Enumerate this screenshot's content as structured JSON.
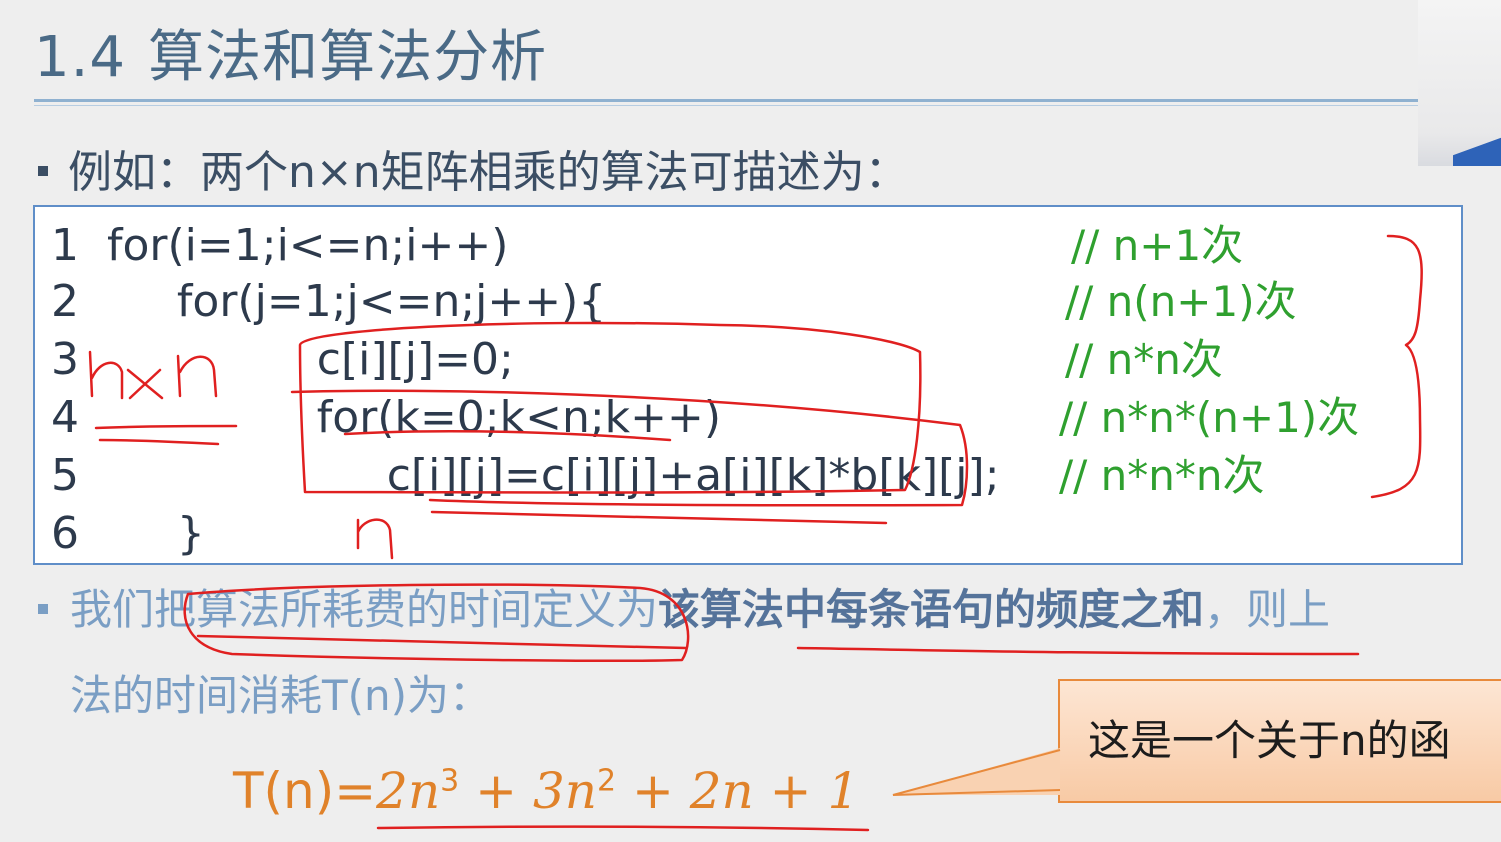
{
  "title": {
    "number": "1.4",
    "text": "算法和算法分析"
  },
  "intro": "例如：两个n×n矩阵相乘的算法可描述为：",
  "code": [
    {
      "ln": "1",
      "text": "for(i=1;i<=n;i++)",
      "comment": "// n+1次"
    },
    {
      "ln": "2",
      "text": "     for(j=1;j<=n;j++){",
      "comment": "// n(n+1)次"
    },
    {
      "ln": "3",
      "text": "               c[i][j]=0;",
      "comment": "// n*n次"
    },
    {
      "ln": "4",
      "text": "               for(k=0;k<n;k++)",
      "comment": "// n*n*(n+1)次"
    },
    {
      "ln": "5",
      "text": "                    c[i][j]=c[i][j]+a[i][k]*b[k][j];",
      "comment": "// n*n*n次"
    },
    {
      "ln": "6",
      "text": "     }",
      "comment": ""
    }
  ],
  "handwriting": {
    "nxn": "n×n",
    "n": "n"
  },
  "bullet2": {
    "part1": "我们把算法所耗费的时间定义为",
    "strong": "该算法中每条语句的频度之和",
    "part2": "，则上",
    "cont": "法的时间消耗T(n)为："
  },
  "formula": {
    "lhs": "T(n)=",
    "t1": "2n",
    "e1": "3",
    "op1": " + ",
    "t2": "3n",
    "e2": "2",
    "op2": " + ",
    "t3": "2n",
    "op3": " + ",
    "t4": "1"
  },
  "callout": "这是一个关于n的函",
  "colors": {
    "title": "#4a6a86",
    "comment": "#2fa02f",
    "formula": "#e0822a",
    "ink": "#e02020",
    "border": "#5f8ec8"
  }
}
